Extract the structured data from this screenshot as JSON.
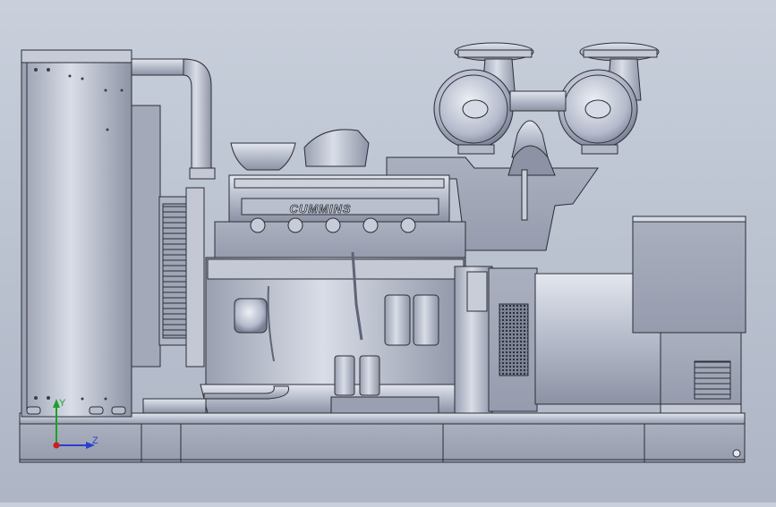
{
  "model": {
    "engine_brand_text": "CUMMINS"
  },
  "triad": {
    "axis_y_label": "Y",
    "axis_z_label": "Z",
    "colors": {
      "y": "#1aa12a",
      "z": "#2a3fd0",
      "x": "#d01c1c"
    }
  },
  "colors": {
    "background": "#bfc6d3",
    "metal_light": "#d8dce6",
    "metal_mid": "#a9afbf",
    "metal_dark": "#6d7386",
    "edge": "#2b2e38"
  }
}
